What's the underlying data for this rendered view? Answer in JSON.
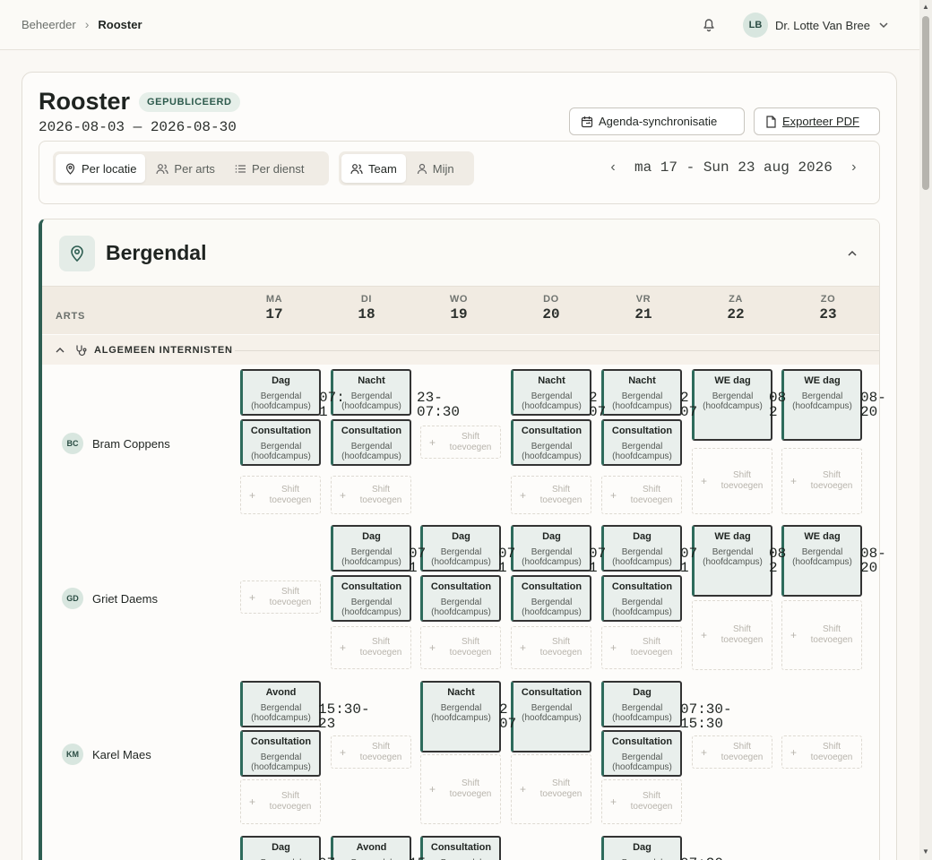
{
  "breadcrumb": {
    "parent": "Beheerder",
    "current": "Rooster"
  },
  "user": {
    "initials": "LB",
    "name": "Dr. Lotte Van Bree"
  },
  "header": {
    "title": "Rooster",
    "status": "GEPUBLICEERD",
    "date_range": "2026-08-03 — 2026-08-30",
    "sync_label": "Agenda-synchronisatie",
    "export_label": "Exporteer PDF"
  },
  "toolbar": {
    "view_tabs": [
      "Per locatie",
      "Per arts",
      "Per dienst"
    ],
    "scope_tabs": [
      "Team",
      "Mijn"
    ],
    "week_label": "ma 17 - Sun 23 aug 2026"
  },
  "location": {
    "name": "Bergendal",
    "col_header": "ARTS",
    "days": [
      {
        "name": "MA",
        "num": "17"
      },
      {
        "name": "DI",
        "num": "18"
      },
      {
        "name": "WO",
        "num": "19"
      },
      {
        "name": "DO",
        "num": "20"
      },
      {
        "name": "VR",
        "num": "21"
      },
      {
        "name": "ZA",
        "num": "22"
      },
      {
        "name": "ZO",
        "num": "23"
      }
    ],
    "group": "ALGEMEEN INTERNISTEN",
    "loc_label": "Bergendal (hoofdcampus)",
    "add_label_1": "Shift",
    "add_label_2": "toevoegen"
  },
  "doctors": [
    {
      "initials": "BC",
      "name": "Bram Coppens"
    },
    {
      "initials": "GD",
      "name": "Griet Daems"
    },
    {
      "initials": "KM",
      "name": "Karel Maes"
    }
  ],
  "shifts": [
    {
      "title": "Dag",
      "row": 0,
      "day": 0
    },
    {
      "title": "Consultation",
      "row": 0,
      "day": 0
    },
    {
      "title": "Nacht",
      "row": 0,
      "day": 1
    },
    {
      "title": "Consultation",
      "row": 0,
      "day": 1
    },
    {
      "title": "Nacht",
      "row": 0,
      "day": 3
    },
    {
      "title": "Consultation",
      "row": 0,
      "day": 3
    },
    {
      "title": "Nacht",
      "row": 0,
      "day": 4
    },
    {
      "title": "Consultation",
      "row": 0,
      "day": 4
    },
    {
      "title": "WE dag",
      "row": 0,
      "day": 5
    },
    {
      "title": "WE dag",
      "row": 0,
      "day": 6
    },
    {
      "title": "Dag",
      "row": 1,
      "day": 1
    },
    {
      "title": "Consultation",
      "row": 1,
      "day": 1
    },
    {
      "title": "Dag",
      "row": 1,
      "day": 2
    },
    {
      "title": "Consultation",
      "row": 1,
      "day": 2
    },
    {
      "title": "Dag",
      "row": 1,
      "day": 3
    },
    {
      "title": "Consultation",
      "row": 1,
      "day": 3
    },
    {
      "title": "Dag",
      "row": 1,
      "day": 4
    },
    {
      "title": "Consultation",
      "row": 1,
      "day": 4
    },
    {
      "title": "WE dag",
      "row": 1,
      "day": 5
    },
    {
      "title": "WE dag",
      "row": 1,
      "day": 6
    },
    {
      "title": "Avond",
      "row": 2,
      "day": 0
    },
    {
      "title": "Consultation",
      "row": 2,
      "day": 0
    },
    {
      "title": "Nacht",
      "row": 2,
      "day": 2
    },
    {
      "title": "Consultation",
      "row": 2,
      "day": 3
    },
    {
      "title": "Dag",
      "row": 2,
      "day": 4
    },
    {
      "title": "Consultation",
      "row": 2,
      "day": 4
    },
    {
      "title": "Dag",
      "row": 3,
      "day": 0
    },
    {
      "title": "Avond",
      "row": 3,
      "day": 1
    },
    {
      "title": "Consultation",
      "row": 3,
      "day": 2
    },
    {
      "title": "Dag",
      "row": 3,
      "day": 4
    }
  ],
  "overflow_text": [
    "07:\n1",
    "23-\n07:30",
    "2\n07",
    "2\n07",
    "08\n2",
    "08-\n20",
    "07\n1",
    "07\n1",
    "07\n1",
    "07\n1",
    "08\n2",
    "08-\n20",
    "15:30-\n23",
    "2\n07",
    "07:30-\n15:30",
    "07",
    "15",
    "07:30"
  ]
}
